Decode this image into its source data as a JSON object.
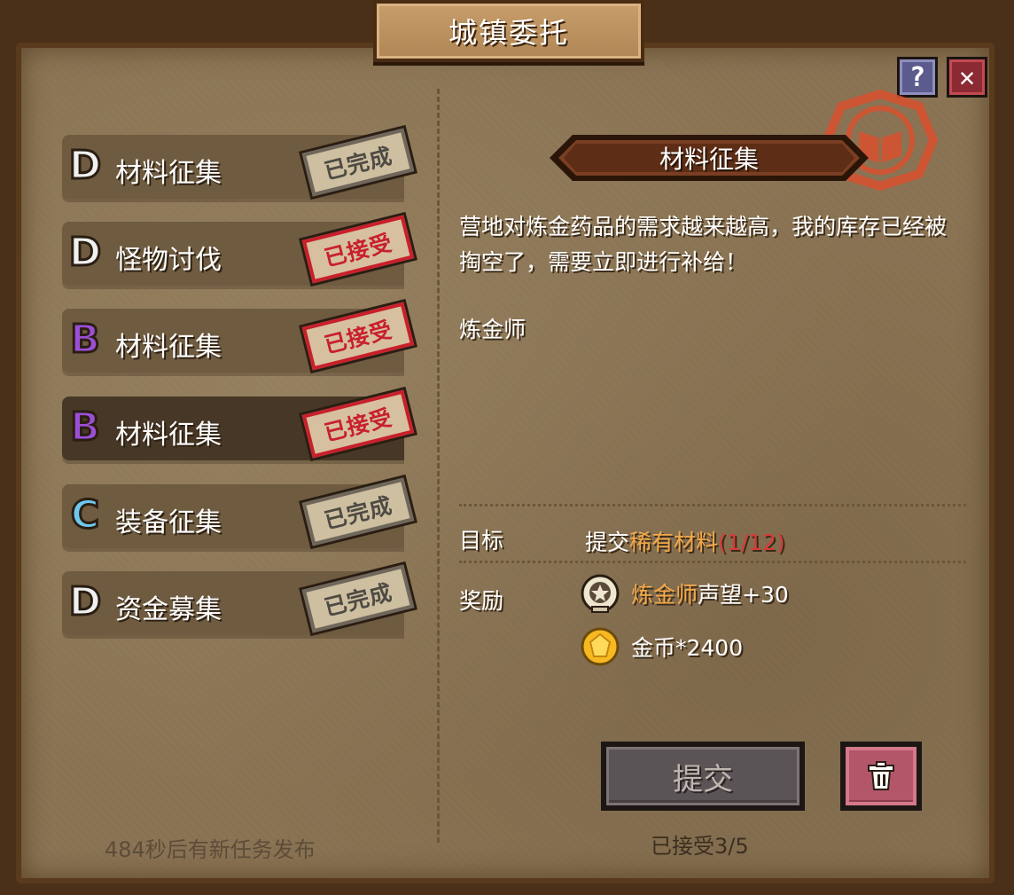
{
  "window": {
    "title": "城镇委托"
  },
  "buttons": {
    "help": "?",
    "close": "✕",
    "submit": "提交"
  },
  "quests": [
    {
      "grade": "D",
      "name": "材料征集",
      "status": "已完成"
    },
    {
      "grade": "D",
      "name": "怪物讨伐",
      "status": "已接受"
    },
    {
      "grade": "B",
      "name": "材料征集",
      "status": "已接受"
    },
    {
      "grade": "B",
      "name": "材料征集",
      "status": "已接受"
    },
    {
      "grade": "C",
      "name": "装备征集",
      "status": "已完成"
    },
    {
      "grade": "D",
      "name": "资金募集",
      "status": "已完成"
    }
  ],
  "selected_index": 3,
  "detail": {
    "title": "材料征集",
    "description": "营地对炼金药品的需求越来越高，我的库存已经被掏空了，需要立即进行补给！",
    "npc": "炼金师",
    "objective_label": "目标",
    "objective_prefix": "提交",
    "objective_item": "稀有材料",
    "objective_progress": "(1/12)",
    "reward_label": "奖励",
    "rewards": [
      {
        "icon": "reputation-medal-icon",
        "highlight": "炼金师",
        "text": "声望+30"
      },
      {
        "icon": "gold-coin-icon",
        "highlight": "",
        "text": "金币*2400"
      }
    ]
  },
  "footer": {
    "timer": "484秒后有新任务发布",
    "accepted_count": "已接受3/5"
  },
  "colors": {
    "grade_d": "#f0f0f0",
    "grade_b": "#9c4fd6",
    "grade_c": "#6fc8f0",
    "stamp_accepted": "#c8202b",
    "highlight": "#f3a84a",
    "progress_incomplete": "#d83a3a"
  }
}
